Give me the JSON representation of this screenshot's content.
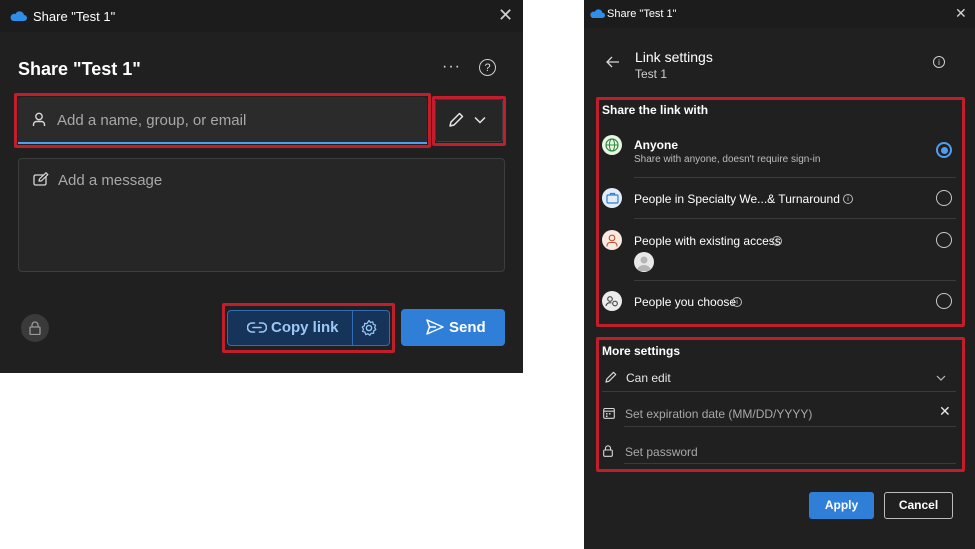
{
  "left": {
    "title": "Share \"Test 1\"",
    "heading": "Share \"Test 1\"",
    "recipient_placeholder": "Add a name, group, or email",
    "message_placeholder": "Add a message",
    "copy_link_label": "Copy link",
    "send_label": "Send"
  },
  "right": {
    "title": "Share \"Test 1\"",
    "heading": "Link settings",
    "subheading": "Test 1",
    "share_section_label": "Share the link with",
    "options": [
      {
        "label": "Anyone",
        "desc": "Share with anyone, doesn't require sign-in",
        "selected": true
      },
      {
        "label": "People in Specialty We...& Turnaround",
        "selected": false
      },
      {
        "label": "People with existing access",
        "selected": false
      },
      {
        "label": "People you choose",
        "selected": false
      }
    ],
    "more_settings_label": "More settings",
    "permission_value": "Can edit",
    "expiration_placeholder": "Set expiration date (MM/DD/YYYY)",
    "password_placeholder": "Set password",
    "apply_label": "Apply",
    "cancel_label": "Cancel"
  },
  "colors": {
    "accent": "#2f7fd8",
    "highlight": "#c21d2a"
  }
}
